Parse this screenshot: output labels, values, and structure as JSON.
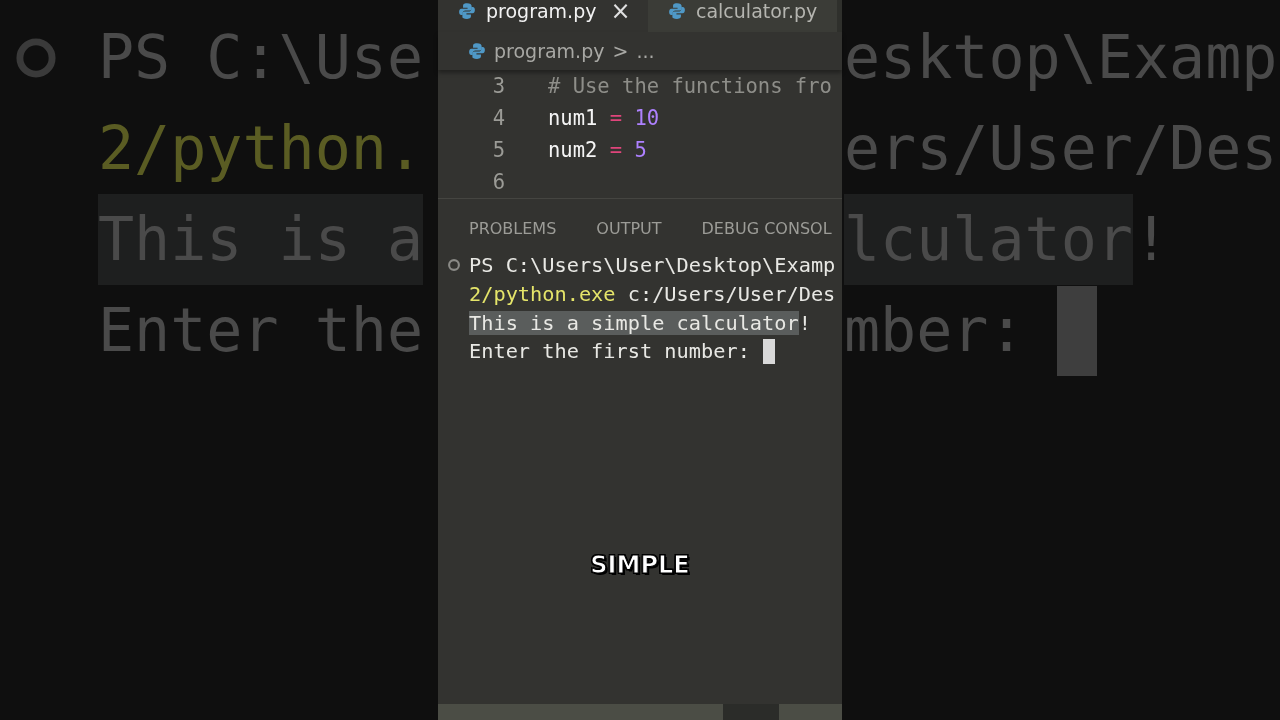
{
  "backdrop": {
    "left_lines": [
      {
        "segments": [
          {
            "text": "PS C:\\Use",
            "kind": "plain",
            "highlighted": false
          }
        ],
        "prompt_marker": true
      },
      {
        "segments": [
          {
            "text": "2/python.",
            "kind": "path",
            "highlighted": false
          }
        ],
        "prompt_marker": false
      },
      {
        "segments": [
          {
            "text": "This is a",
            "kind": "plain",
            "highlighted": true
          }
        ],
        "prompt_marker": false
      },
      {
        "segments": [
          {
            "text": "Enter the",
            "kind": "plain",
            "highlighted": false
          }
        ],
        "prompt_marker": false
      }
    ],
    "right_lines": [
      {
        "segments": [
          {
            "text": "esktop\\Examp",
            "kind": "plain",
            "highlighted": false
          }
        ],
        "cursor": false
      },
      {
        "segments": [
          {
            "text": "ers/User/Des",
            "kind": "plain",
            "highlighted": false
          }
        ],
        "cursor": false
      },
      {
        "segments": [
          {
            "text": "lculator",
            "kind": "plain",
            "highlighted": true
          },
          {
            "text": "!",
            "kind": "plain",
            "highlighted": false
          }
        ],
        "cursor": false
      },
      {
        "segments": [
          {
            "text": "mber:",
            "kind": "plain",
            "highlighted": false
          }
        ],
        "cursor": true
      }
    ]
  },
  "editor": {
    "tabs": [
      {
        "label": "program.py",
        "selected": true,
        "close": "×"
      },
      {
        "label": "calculator.py",
        "selected": false
      }
    ],
    "breadcrumb": {
      "file": "program.py",
      "separator": ">",
      "more": "..."
    },
    "code_lines": [
      {
        "number": "3",
        "tokens": [
          {
            "text": "# Use the functions fro",
            "kind": "comment"
          }
        ]
      },
      {
        "number": "4",
        "tokens": [
          {
            "text": "num1",
            "kind": "name"
          },
          {
            "text": "=",
            "kind": "operator"
          },
          {
            "text": "10",
            "kind": "number"
          }
        ]
      },
      {
        "number": "5",
        "tokens": [
          {
            "text": "num2",
            "kind": "name"
          },
          {
            "text": "=",
            "kind": "operator"
          },
          {
            "text": "5",
            "kind": "number"
          }
        ]
      },
      {
        "number": "6"
      }
    ]
  },
  "panel_tabs": [
    {
      "label": "PROBLEMS",
      "selected": false
    },
    {
      "label": "OUTPUT",
      "selected": false
    },
    {
      "label": "DEBUG CONSOL",
      "selected": false
    }
  ],
  "terminal": {
    "lines": [
      {
        "segments": [
          {
            "text": "PS C:\\Users\\User\\Desktop\\Examp",
            "kind": "plain",
            "highlighted": false
          }
        ],
        "prompt_marker": true,
        "cursor": false
      },
      {
        "segments": [
          {
            "text": "2/python.exe",
            "kind": "path",
            "highlighted": false
          },
          {
            "text": " c:/Users/User/Des",
            "kind": "plain",
            "highlighted": false
          }
        ],
        "prompt_marker": false,
        "cursor": false
      },
      {
        "segments": [
          {
            "text": "This is a simple calculator",
            "kind": "plain",
            "highlighted": true
          },
          {
            "text": "!",
            "kind": "plain",
            "highlighted": false
          }
        ],
        "prompt_marker": false,
        "cursor": false
      },
      {
        "segments": [
          {
            "text": "Enter the first number:",
            "kind": "plain",
            "highlighted": false
          }
        ],
        "prompt_marker": false,
        "cursor": true
      }
    ]
  },
  "caption": "SIMPLE"
}
